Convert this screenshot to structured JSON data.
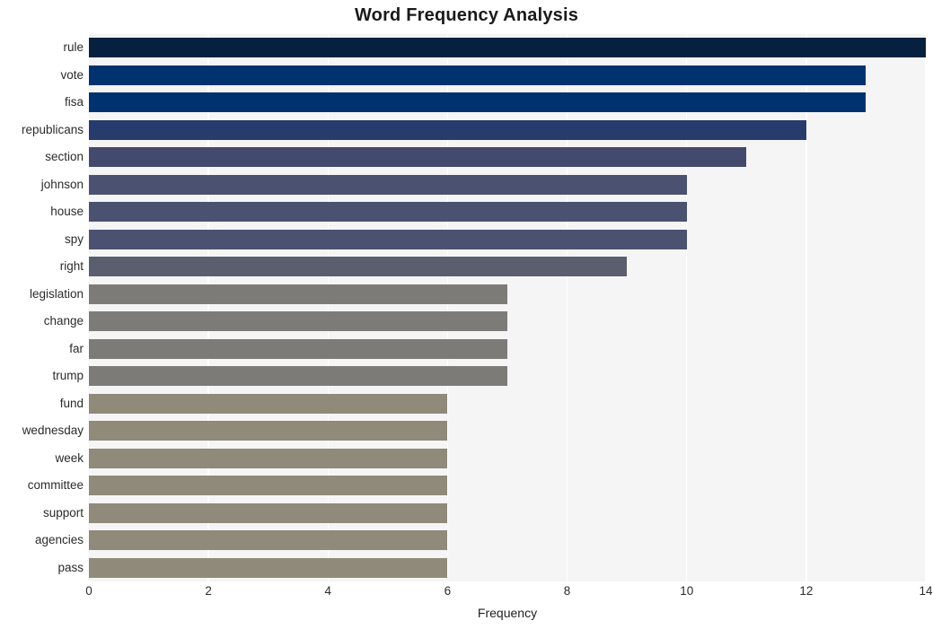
{
  "chart_data": {
    "type": "bar",
    "orientation": "horizontal",
    "title": "Word Frequency Analysis",
    "xlabel": "Frequency",
    "ylabel": "",
    "xlim": [
      0,
      14.0
    ],
    "xticks": [
      0,
      2,
      4,
      6,
      8,
      10,
      12,
      14
    ],
    "xticklabels": [
      "0",
      "2",
      "4",
      "6",
      "8",
      "10",
      "12",
      "14"
    ],
    "grid": true,
    "grid_axis": "x",
    "legend": false,
    "categories": [
      "rule",
      "vote",
      "fisa",
      "republicans",
      "section",
      "johnson",
      "house",
      "spy",
      "right",
      "legislation",
      "change",
      "far",
      "trump",
      "fund",
      "wednesday",
      "week",
      "committee",
      "support",
      "agencies",
      "pass"
    ],
    "values": [
      14,
      13,
      13,
      12,
      11,
      10,
      10,
      10,
      9,
      7,
      7,
      7,
      7,
      6,
      6,
      6,
      6,
      6,
      6,
      6
    ],
    "bar_colors": [
      "#06213f",
      "#013270",
      "#013270",
      "#273c6d",
      "#44496e",
      "#4b5170",
      "#4b5170",
      "#4b5170",
      "#5b5e6e",
      "#7c7b78",
      "#7c7b78",
      "#7c7b78",
      "#7c7b78",
      "#8f8a79",
      "#8f8a79",
      "#8f8a79",
      "#8f8a79",
      "#8f8a79",
      "#8f8a79",
      "#8f8a79"
    ],
    "plot_background": "#f5f5f6",
    "gridline_color": "#ffffff",
    "figure_background": "#ffffff"
  }
}
